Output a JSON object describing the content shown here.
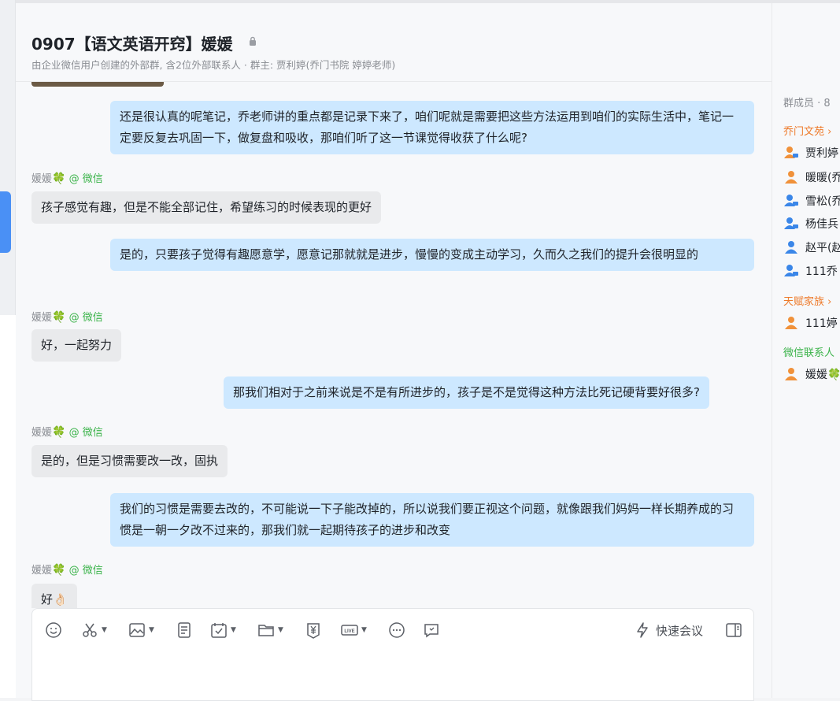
{
  "window": {
    "minimize_glyph": "–"
  },
  "header": {
    "title": "0907【语文英语开窍】媛媛",
    "subtitle": "由企业微信用户创建的外部群, 含2位外部联系人 · 群主: 贾利婷(乔门书院 婷婷老师)"
  },
  "messages": [
    {
      "dir": "out",
      "text": "还是很认真的呢笔记，乔老师讲的重点都是记录下来了，咱们呢就是需要把这些方法运用到咱们的实际生活中，笔记一定要反复去巩固一下，做复盘和吸收，那咱们听了这一节课觉得收获了什么呢?"
    },
    {
      "dir": "in",
      "sender": "媛媛",
      "source": "@ 微信",
      "text": "孩子感觉有趣，但是不能全部记住，希望练习的时候表现的更好"
    },
    {
      "dir": "out",
      "text": "是的，只要孩子觉得有趣愿意学，愿意记那就就是进步，慢慢的变成主动学习，久而久之我们的提升会很明显的"
    },
    {
      "dir": "in",
      "sender": "媛媛",
      "source": "@ 微信",
      "text": "好，一起努力"
    },
    {
      "dir": "out",
      "text": "那我们相对于之前来说是不是有所进步的，孩子是不是觉得这种方法比死记硬背要好很多?"
    },
    {
      "dir": "in",
      "sender": "媛媛",
      "source": "@ 微信",
      "text": "是的，但是习惯需要改一改，固执"
    },
    {
      "dir": "out",
      "text": "我们的习惯是需要去改的，不可能说一下子能改掉的，所以说我们要正视这个问题，就像跟我们妈妈一样长期养成的习惯是一朝一夕改不过来的，那我们就一起期待孩子的进步和改变"
    },
    {
      "dir": "in",
      "sender": "媛媛",
      "source": "@ 微信",
      "text": "好👌🏻"
    }
  ],
  "composer": {
    "tools": [
      "emoji-icon",
      "scissors-icon",
      "image-icon",
      "document-icon",
      "task-icon",
      "folder-icon",
      "payment-icon",
      "live-icon",
      "more-icon",
      "comment-icon"
    ],
    "meeting_label": "快速会议"
  },
  "sidebar": {
    "members_title": "群成员 · 8",
    "groups": [
      {
        "label": "乔门文苑 ›",
        "color": "orange",
        "members": [
          {
            "name": "贾利婷",
            "avatar": "orange-pc"
          },
          {
            "name": "暖暖(乔",
            "avatar": "orange"
          },
          {
            "name": "雪松(乔",
            "avatar": "blue-pc"
          },
          {
            "name": "杨佳兵",
            "avatar": "blue-pc"
          },
          {
            "name": "赵平(赵",
            "avatar": "blue"
          },
          {
            "name": "111乔",
            "avatar": "blue-pc"
          }
        ]
      },
      {
        "label": "天赋家族 ›",
        "color": "orange",
        "members": [
          {
            "name": "111婷",
            "avatar": "orange"
          }
        ]
      },
      {
        "label": "微信联系人",
        "color": "green",
        "members": [
          {
            "name": "媛媛🍀",
            "avatar": "orange"
          }
        ]
      }
    ]
  },
  "colors": {
    "outgoing_bubble": "#cde8ff",
    "incoming_bubble": "#e9eaec",
    "accent": "#4a90f5",
    "wechat_green": "#3bb34a",
    "org_orange": "#ee7a2a"
  }
}
